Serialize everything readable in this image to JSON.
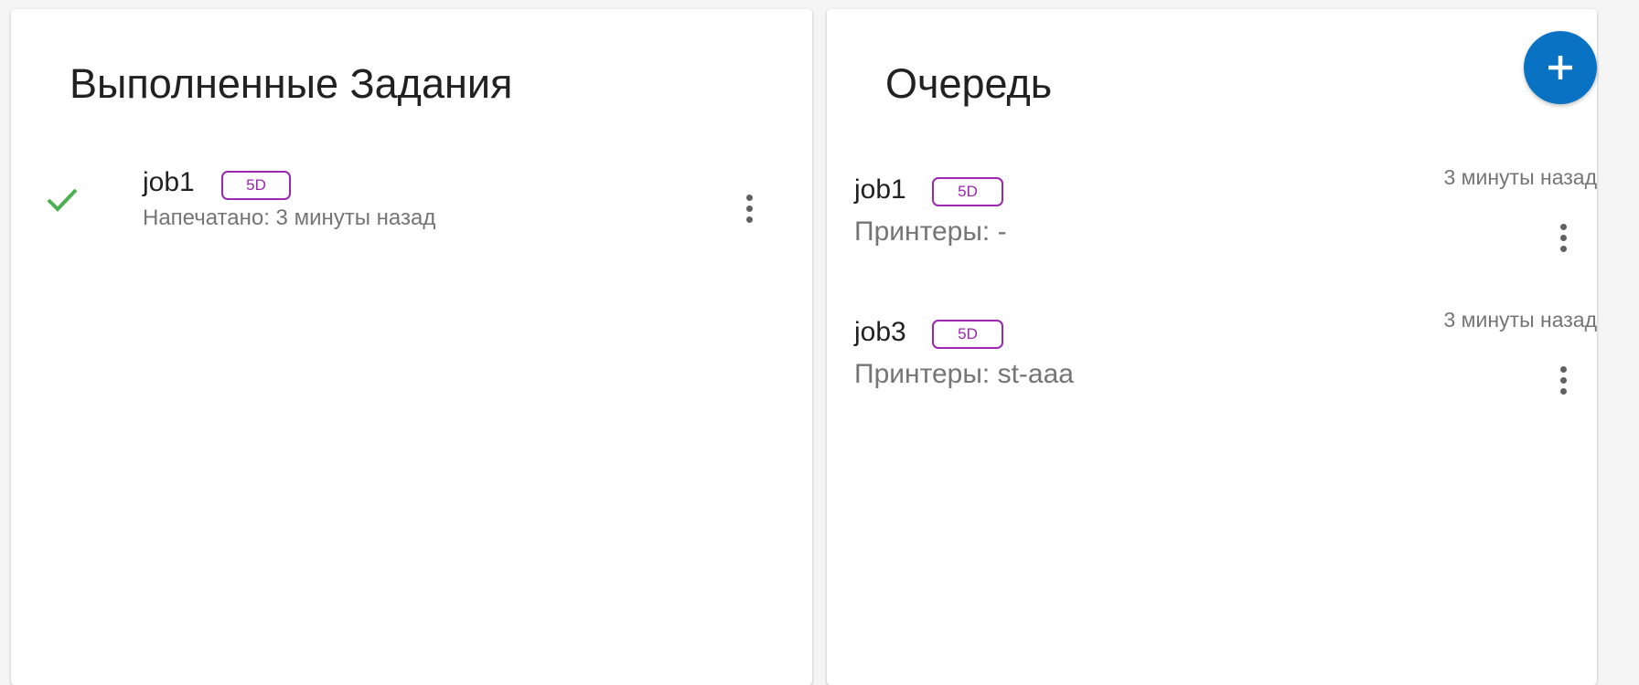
{
  "completed": {
    "title": "Выполненные Задания",
    "jobs": [
      {
        "name": "job1",
        "tag": "5D",
        "printed": "Напечатано: 3 минуты назад"
      }
    ]
  },
  "queue": {
    "title": "Очередь",
    "jobs": [
      {
        "name": "job1",
        "tag": "5D",
        "printers": "Принтеры: -",
        "time": "3 минуты назад"
      },
      {
        "name": "job3",
        "tag": "5D",
        "printers": "Принтеры: st-aaa",
        "time": "3 минуты назад"
      }
    ]
  },
  "colors": {
    "accent_blue": "#0a72c2",
    "tag_purple": "#9c27b0",
    "check_green": "#4caf50"
  },
  "icons": {
    "completed_status": "check-icon",
    "row_menu": "more-vert-icon",
    "add": "plus-icon"
  }
}
